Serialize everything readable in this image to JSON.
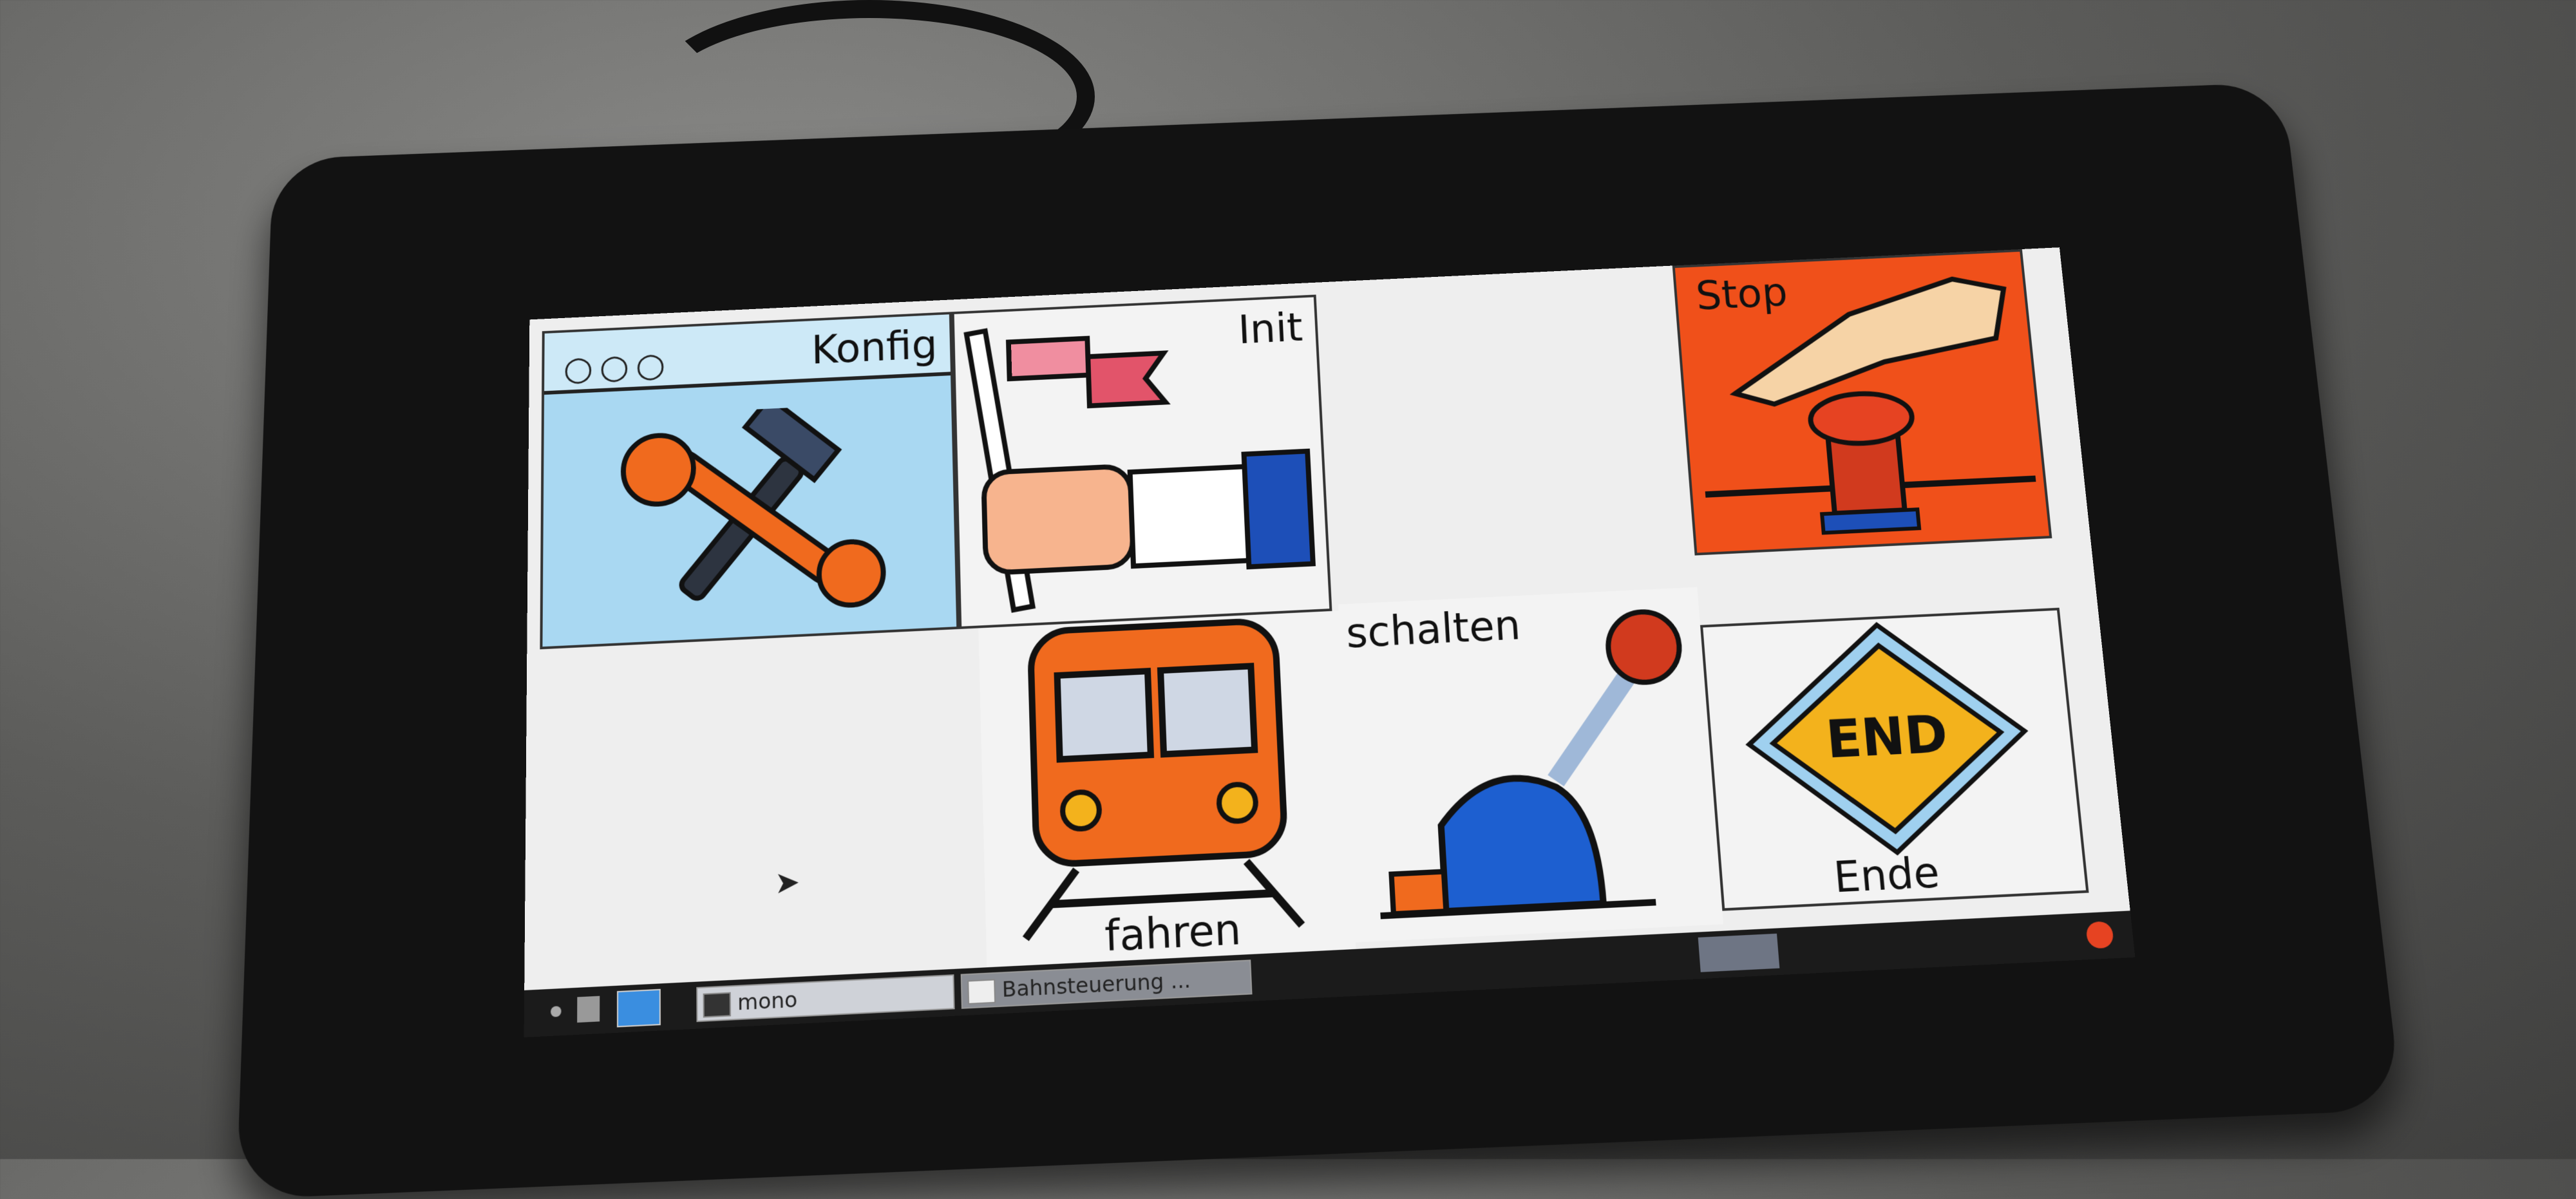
{
  "tiles": {
    "konfig": {
      "label": "Konfig",
      "icon": "tools-icon"
    },
    "init": {
      "label": "Init",
      "icon": "flag-icon"
    },
    "stop": {
      "label": "Stop",
      "icon": "emergency-stop-icon",
      "color": "#f0501a"
    },
    "fahren": {
      "label": "fahren",
      "icon": "train-icon"
    },
    "schalten": {
      "label": "schalten",
      "icon": "lever-icon"
    },
    "ende": {
      "label": "Ende",
      "icon": "end-sign-icon",
      "sign_text": "END"
    }
  },
  "taskbar": {
    "windows": [
      {
        "label": "mono"
      },
      {
        "label": "Bahnsteuerung ..."
      }
    ]
  },
  "colors": {
    "konfig_bg": "#a9d8f2",
    "stop_bg": "#f0501a",
    "end_sign": "#f3b21c",
    "taskbar": "#1b1b1b"
  }
}
